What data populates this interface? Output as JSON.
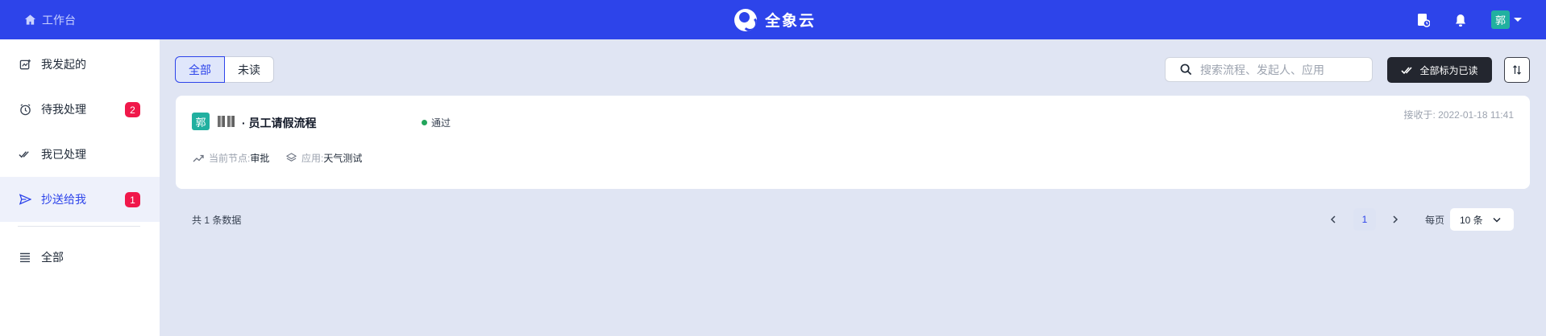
{
  "header": {
    "workspace_label": "工作台",
    "brand_name": "全象云",
    "user_avatar_text": "郭",
    "bg_color": "#2d44ea"
  },
  "sidebar": {
    "items": [
      {
        "label": "我发起的",
        "icon": "initiated-icon"
      },
      {
        "label": "待我处理",
        "icon": "clock-icon",
        "badge": "2"
      },
      {
        "label": "我已处理",
        "icon": "double-check-icon"
      },
      {
        "label": "抄送给我",
        "icon": "send-icon",
        "badge": "1",
        "active": true
      },
      {
        "label": "全部",
        "icon": "list-icon"
      }
    ]
  },
  "toolbar": {
    "tabs": [
      {
        "label": "全部",
        "active": true
      },
      {
        "label": "未读",
        "active": false
      }
    ],
    "search_placeholder": "搜索流程、发起人、应用",
    "mark_all_label": "全部标为已读"
  },
  "items": [
    {
      "avatar_text": "郭",
      "title": "· 员工请假流程",
      "status": "通过",
      "status_color": "#22a55b",
      "received": "接收于: 2022-01-18 11:41",
      "node_label": "当前节点:",
      "node_value": "审批",
      "app_label": "应用:",
      "app_value": "天气测试"
    }
  ],
  "pagination": {
    "total_text": "共 1 条数据",
    "current_page": "1",
    "per_page_label": "每页",
    "page_size": "10 条"
  }
}
